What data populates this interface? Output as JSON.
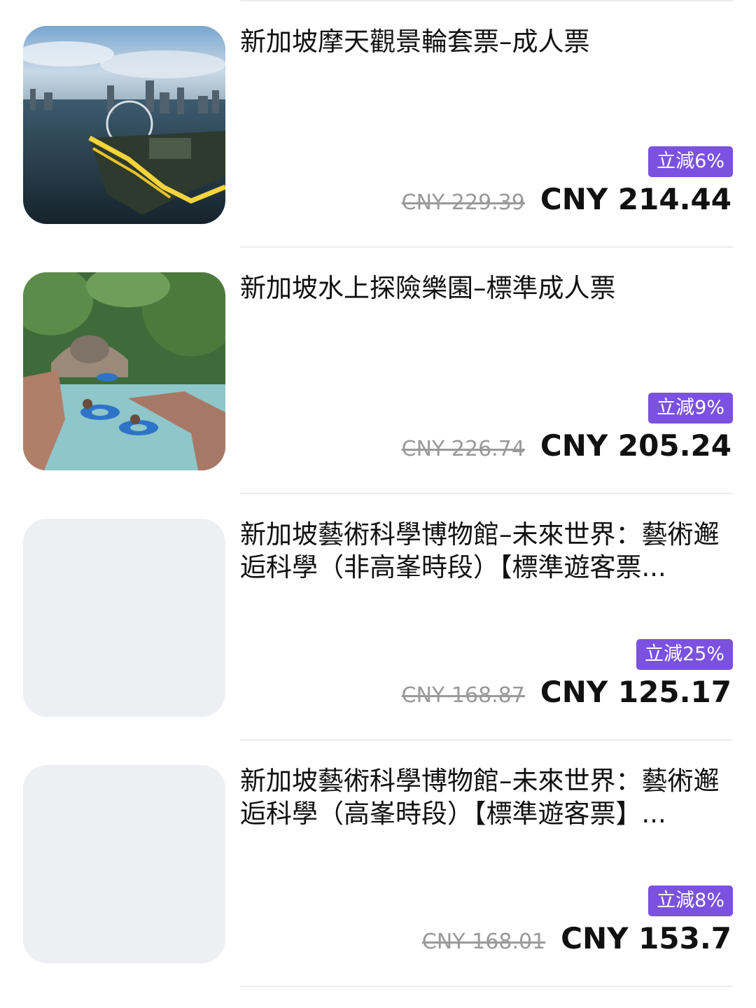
{
  "products": [
    {
      "title": "新加坡摩天觀景輪套票–成人票",
      "discount": "立減6%",
      "original_price": "CNY 229.39",
      "price": "CNY 214.44",
      "image": "singapore-flyer-photo"
    },
    {
      "title": "新加坡水上探險樂園–標準成人票",
      "discount": "立減9%",
      "original_price": "CNY 226.74",
      "price": "CNY 205.24",
      "image": "water-park-photo"
    },
    {
      "title": "新加坡藝術科學博物館–未來世界：藝術邂逅科學（非高峯時段）【標準遊客票...",
      "discount": "立減25%",
      "original_price": "CNY 168.87",
      "price": "CNY 125.17",
      "image": "placeholder"
    },
    {
      "title": "新加坡藝術科學博物館–未來世界：藝術邂逅科學（高峯時段）【標準遊客票】...",
      "discount": "立減8%",
      "original_price": "CNY 168.01",
      "price": "CNY 153.7",
      "image": "placeholder"
    }
  ],
  "colors": {
    "badge": "#7b51e0",
    "placeholder": "#eeeff3",
    "divider": "#ebebeb"
  }
}
